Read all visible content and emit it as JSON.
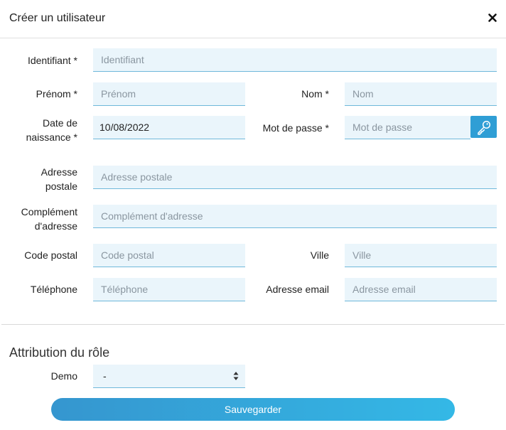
{
  "dialog": {
    "title": "Créer un utilisateur",
    "close_icon": "close-icon"
  },
  "form": {
    "identifiant": {
      "label": "Identifiant *",
      "placeholder": "Identifiant",
      "value": ""
    },
    "prenom": {
      "label": "Prénom *",
      "placeholder": "Prénom",
      "value": ""
    },
    "nom": {
      "label": "Nom *",
      "placeholder": "Nom",
      "value": ""
    },
    "date_naissance": {
      "label_line1": "Date de",
      "label_line2": "naissance *",
      "placeholder": "",
      "value": "10/08/2022"
    },
    "mot_de_passe": {
      "label": "Mot de passe *",
      "placeholder": "Mot de passe",
      "value": "",
      "generate_icon": "key-icon"
    },
    "adresse_postale": {
      "label_line1": "Adresse",
      "label_line2": "postale",
      "placeholder": "Adresse postale",
      "value": ""
    },
    "complement": {
      "label_line1": "Complément",
      "label_line2": "d'adresse",
      "placeholder": "Complément d'adresse",
      "value": ""
    },
    "code_postal": {
      "label": "Code postal",
      "placeholder": "Code postal",
      "value": ""
    },
    "ville": {
      "label": "Ville",
      "placeholder": "Ville",
      "value": ""
    },
    "telephone": {
      "label": "Téléphone",
      "placeholder": "Téléphone",
      "value": ""
    },
    "email": {
      "label": "Adresse email",
      "placeholder": "Adresse email",
      "value": ""
    }
  },
  "role_section": {
    "title": "Attribution du rôle",
    "demo_label": "Demo",
    "demo_selected": "-"
  },
  "actions": {
    "save_label": "Sauvegarder"
  },
  "colors": {
    "input_bg": "#eaf5fb",
    "input_border": "#6fb8da",
    "accent": "#2f9ed5",
    "button_gradient_start": "#3596cf",
    "button_gradient_end": "#34b8e6"
  }
}
